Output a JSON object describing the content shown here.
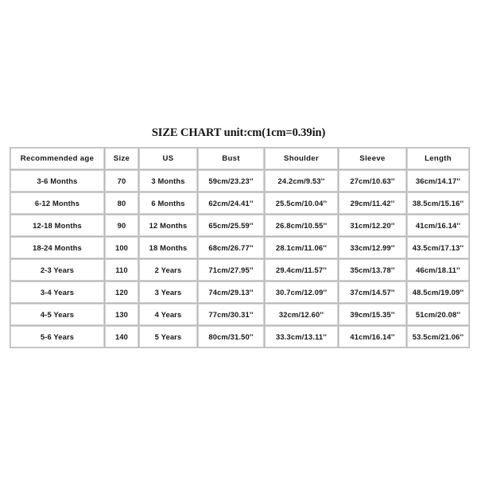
{
  "title": "SIZE CHART unit:cm(1cm=0.39in)",
  "chart_data": {
    "type": "table",
    "title": "SIZE CHART unit:cm(1cm=0.39in)",
    "columns": [
      "Recommended age",
      "Size",
      "US",
      "Bust",
      "Shoulder",
      "Sleeve",
      "Length"
    ],
    "rows": [
      [
        "3-6 Months",
        "70",
        "3 Months",
        "59cm/23.23''",
        "24.2cm/9.53''",
        "27cm/10.63''",
        "36cm/14.17''"
      ],
      [
        "6-12 Months",
        "80",
        "6 Months",
        "62cm/24.41''",
        "25.5cm/10.04''",
        "29cm/11.42''",
        "38.5cm/15.16''"
      ],
      [
        "12-18 Months",
        "90",
        "12 Months",
        "65cm/25.59''",
        "26.8cm/10.55''",
        "31cm/12.20''",
        "41cm/16.14''"
      ],
      [
        "18-24 Months",
        "100",
        "18 Months",
        "68cm/26.77''",
        "28.1cm/11.06''",
        "33cm/12.99''",
        "43.5cm/17.13''"
      ],
      [
        "2-3 Years",
        "110",
        "2 Years",
        "71cm/27.95''",
        "29.4cm/11.57''",
        "35cm/13.78''",
        "46cm/18.11''"
      ],
      [
        "3-4 Years",
        "120",
        "3 Years",
        "74cm/29.13''",
        "30.7cm/12.09''",
        "37cm/14.57''",
        "48.5cm/19.09''"
      ],
      [
        "4-5 Years",
        "130",
        "4 Years",
        "77cm/30.31''",
        "32cm/12.60''",
        "39cm/15.35''",
        "51cm/20.08''"
      ],
      [
        "5-6 Years",
        "140",
        "5 Years",
        "80cm/31.50''",
        "33.3cm/13.11''",
        "41cm/16.14''",
        "53.5cm/21.06''"
      ]
    ],
    "units_note": "1cm=0.39in",
    "colors": {
      "background": "#ffffff",
      "text": "#171717",
      "border": "#d2d2d2",
      "grid": "#b9b9b9"
    }
  }
}
